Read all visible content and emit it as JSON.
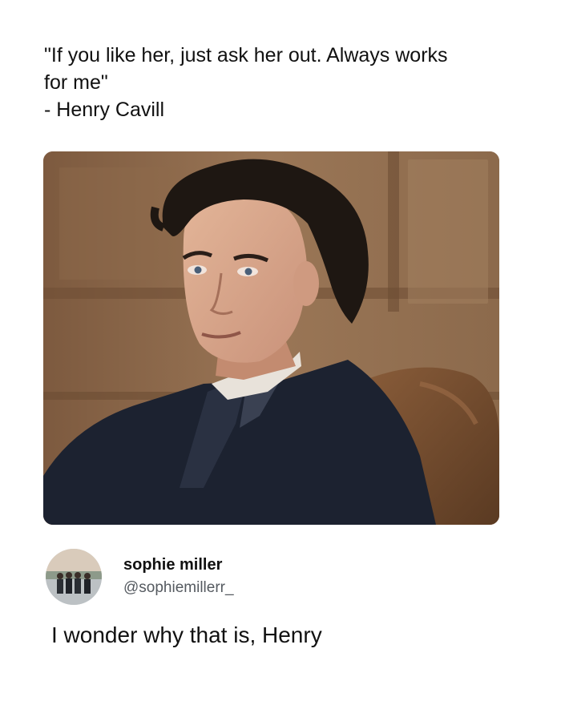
{
  "post": {
    "quote_lines": [
      "\"If you like her, just ask her out. Always works",
      "for me\"",
      "- Henry Cavill"
    ]
  },
  "photo": {
    "subject": "man in dark suit seated in brown leather chair",
    "colors": {
      "background": "#8a6446",
      "panel": "#a07a58",
      "chair": "#6e4a2e",
      "suit": "#1c2230",
      "skin": "#d9a88c",
      "hair": "#1e1712"
    }
  },
  "reply": {
    "user_name": "sophie miller",
    "user_handle": "@sophiemillerr_",
    "text": "I wonder why that is, Henry"
  }
}
